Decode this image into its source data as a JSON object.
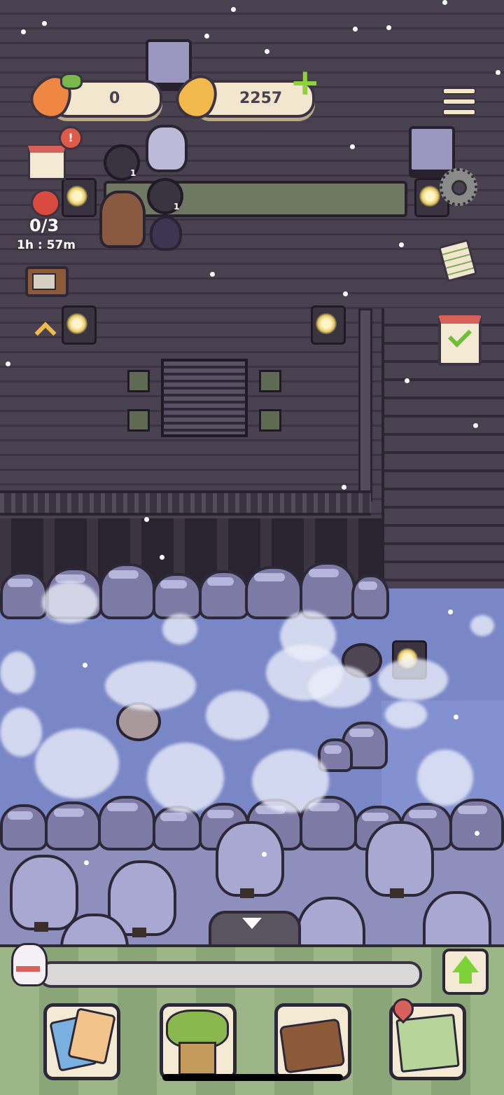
{
  "hud": {
    "carrots": "0",
    "golden_carrots": "2257",
    "plus_label": "+",
    "visitor_count": "0/3",
    "visitor_timer": "1h : 57m",
    "alert": "!",
    "order_badge_1": "1",
    "order_badge_2": "1"
  },
  "icons": {
    "carrot": "carrot-icon",
    "golden_carrot": "golden-carrot-icon",
    "add": "plus-icon",
    "menu": "hamburger-menu-icon",
    "settings": "gear-icon",
    "checklist": "notepad-icon",
    "calendar": "calendar-check-icon",
    "tv": "tv-icon",
    "up": "chevron-up-icon",
    "arrow_up_green": "upgrade-arrow-icon",
    "down": "triangle-down-icon"
  },
  "nav": {
    "items": [
      {
        "id": "cards",
        "icon": "cards-icon"
      },
      {
        "id": "house",
        "icon": "tree-house-icon"
      },
      {
        "id": "suitcase",
        "icon": "suitcase-icon"
      },
      {
        "id": "map",
        "icon": "map-icon"
      }
    ]
  },
  "colors": {
    "wood": "#4a4150",
    "water": "#7a87c7",
    "ground": "#8f8fbe",
    "bar_green": "#9db688",
    "accent_green": "#8fd23a"
  }
}
